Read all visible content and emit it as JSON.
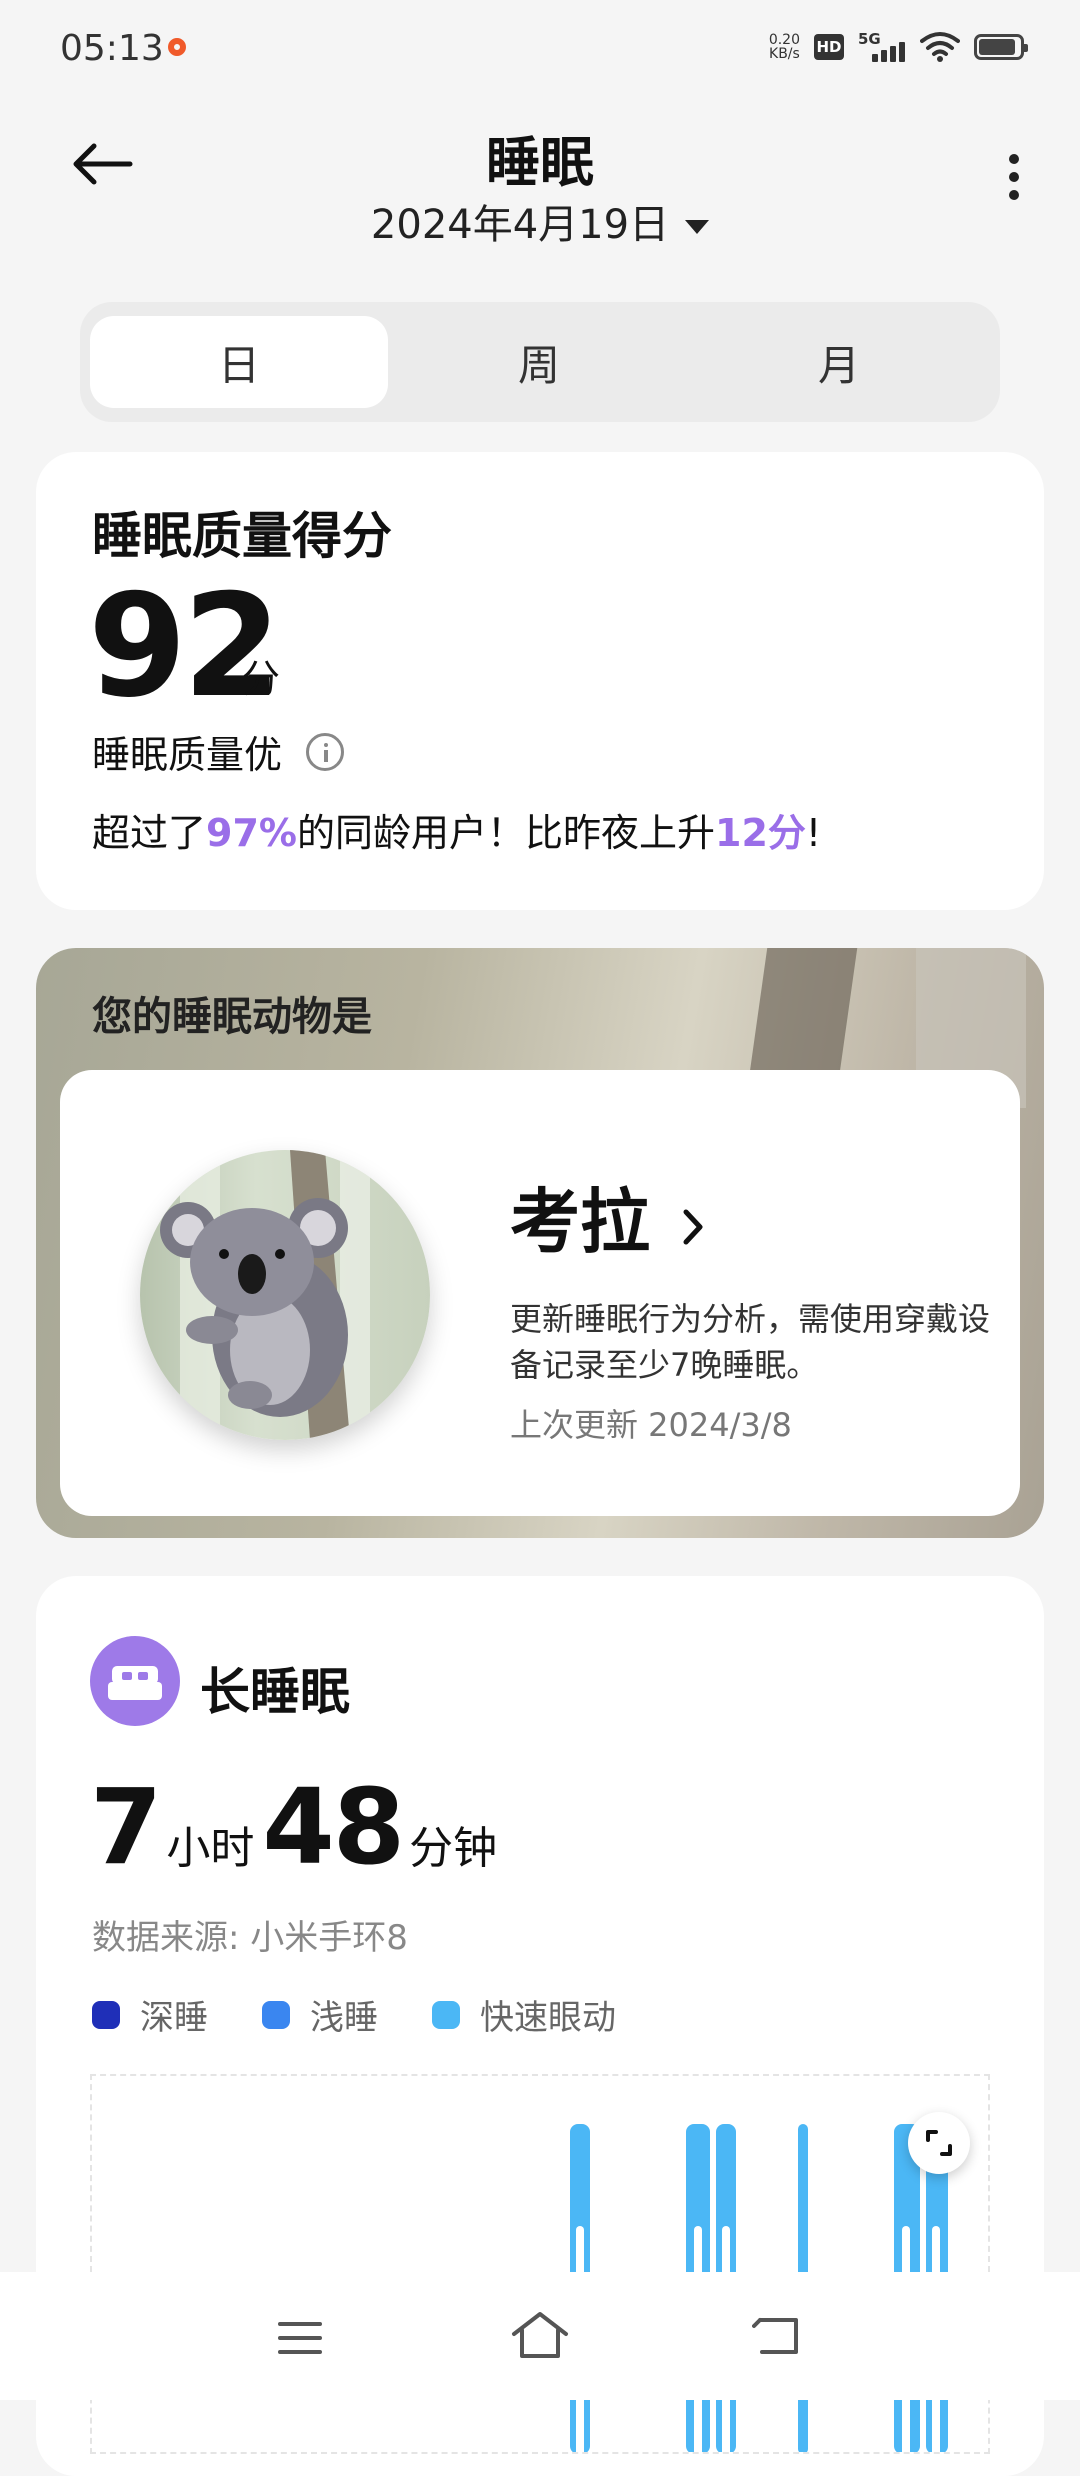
{
  "status_bar": {
    "time": "05:13",
    "speed_value": "0.20",
    "speed_unit": "KB/s",
    "hd": "HD",
    "network": "5G"
  },
  "header": {
    "title": "睡眠",
    "date": "2024年4月19日"
  },
  "tabs": [
    {
      "label": "日",
      "active": true
    },
    {
      "label": "周",
      "active": false
    },
    {
      "label": "月",
      "active": false
    }
  ],
  "score_card": {
    "label": "睡眠质量得分",
    "score": "92",
    "unit": "分",
    "quality": "睡眠质量优",
    "compare_prefix": "超过了",
    "compare_percent": "97%",
    "compare_mid": "的同龄用户！比昨夜上升",
    "compare_points": "12分",
    "compare_suffix": "!"
  },
  "animal_card": {
    "heading": "您的睡眠动物是",
    "animal_name": "考拉",
    "description": "更新睡眠行为分析，需使用穿戴设备记录至少7晚睡眠。",
    "last_update": "上次更新 2024/3/8"
  },
  "sleep_card": {
    "title": "长睡眠",
    "hours": "7",
    "hours_unit": "小时",
    "minutes": "48",
    "minutes_unit": "分钟",
    "source": "数据来源: 小米手环8",
    "legend": [
      {
        "label": "深睡",
        "color": "#1f2fb8"
      },
      {
        "label": "浅睡",
        "color": "#3a86f0"
      },
      {
        "label": "快速眼动",
        "color": "#4bb7f5"
      }
    ]
  },
  "colors": {
    "accent_purple": "#9a6ee8",
    "deep": "#1f2fb8",
    "light": "#3a86f0",
    "rem": "#4bb7f5"
  },
  "icons": [
    "back-arrow-icon",
    "more-vertical-icon",
    "info-icon",
    "chevron-right-icon",
    "bed-icon",
    "expand-icon",
    "menu-icon",
    "home-icon",
    "back-nav-icon"
  ]
}
